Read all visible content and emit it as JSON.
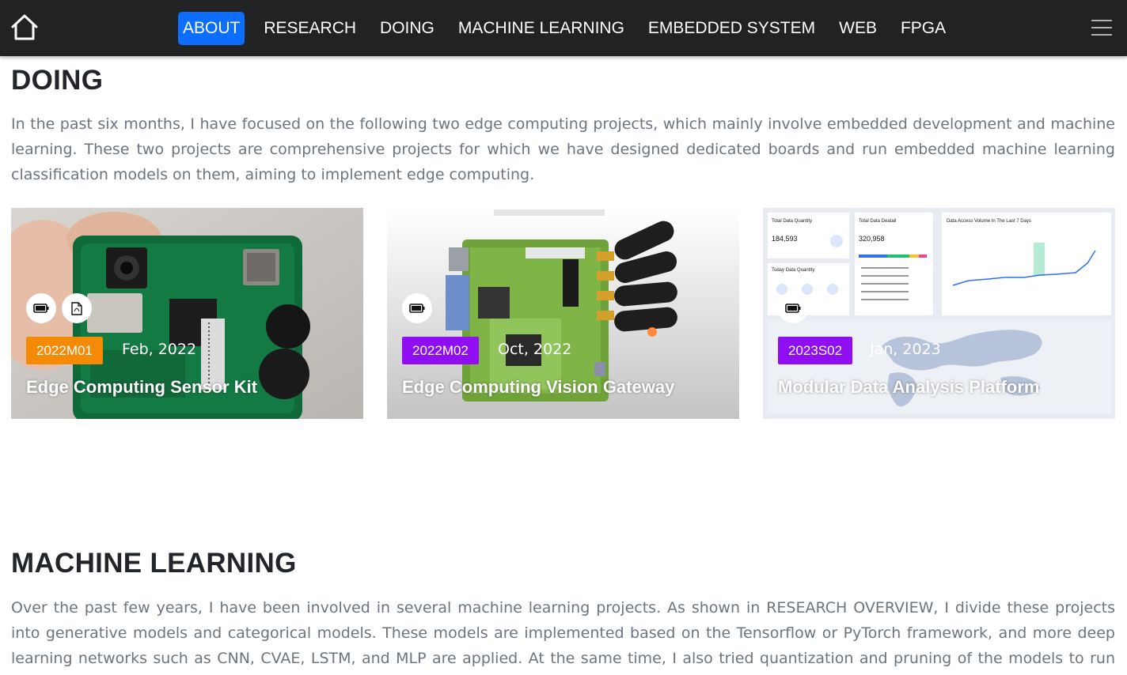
{
  "nav": {
    "items": [
      {
        "label": "ABOUT",
        "active": true
      },
      {
        "label": "RESEARCH",
        "active": false
      },
      {
        "label": "DOING",
        "active": false
      },
      {
        "label": "MACHINE LEARNING",
        "active": false
      },
      {
        "label": "EMBEDDED SYSTEM",
        "active": false
      },
      {
        "label": "WEB",
        "active": false
      },
      {
        "label": "FPGA",
        "active": false
      }
    ],
    "home_icon": "home-icon",
    "menu_icon": "hamburger-menu-icon",
    "bg_color": "#202223",
    "active_color": "#0d6efd"
  },
  "doing": {
    "title": "DOING",
    "text": "In the past six months, I have focused on the following two edge computing projects, which mainly involve embedded development and machine learning. These two projects are comprehensive projects for which we have designed dedicated boards and run embedded machine learning classification models on them, aiming to implement edge computing.",
    "cards": [
      {
        "tag": "2022M01",
        "tag_color": "#f58a07",
        "date": "Feb, 2022",
        "title": "Edge Computing Sensor Kit",
        "icons": [
          "battery-icon",
          "pdf-icon"
        ]
      },
      {
        "tag": "2022M02",
        "tag_color": "#8f0ef2",
        "date": "Oct, 2022",
        "title": "Edge Computing Vision Gateway",
        "icons": [
          "battery-icon"
        ]
      },
      {
        "tag": "2023S02",
        "tag_color": "#8f0ef2",
        "date": "Jan, 2023",
        "title": "Modular Data Analysis Platform",
        "icons": [
          "battery-icon"
        ]
      }
    ]
  },
  "dashboard": {
    "p1_title": "Total Data Quantity",
    "p1_value": "184,593",
    "p2_title": "Total Data Deatail",
    "p2_value": "320,958",
    "p3_title": "Data Access Volume In The Last 7 Days",
    "p4_title": "Today Data Quantity"
  },
  "ml": {
    "title": "MACHINE LEARNING",
    "text": "Over the past few years, I have been involved in several machine learning projects. As shown in RESEARCH OVERVIEW, I divide these projects into generative models and categorical models. These models are implemented based on the Tensorflow or PyTorch framework, and more deep learning networks such as CNN, CVAE, LSTM, and MLP are applied. At the same time, I also tried quantization and pruning of the models to run these models"
  }
}
